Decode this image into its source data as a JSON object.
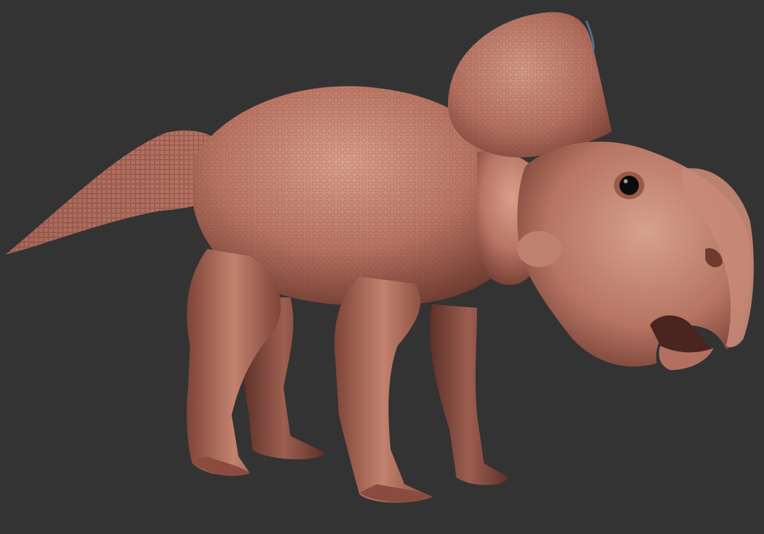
{
  "viewport": {
    "background_color": "#333333",
    "subject": "protoceratops-sculpt",
    "colors": {
      "skin_base": "#b97563",
      "skin_light": "#d9a08c",
      "skin_shadow": "#6e3a30",
      "skin_deep": "#4a2520",
      "beak": "#c98a78",
      "eye": "#0b0b0b",
      "rim_light": "#5b7fae"
    }
  }
}
